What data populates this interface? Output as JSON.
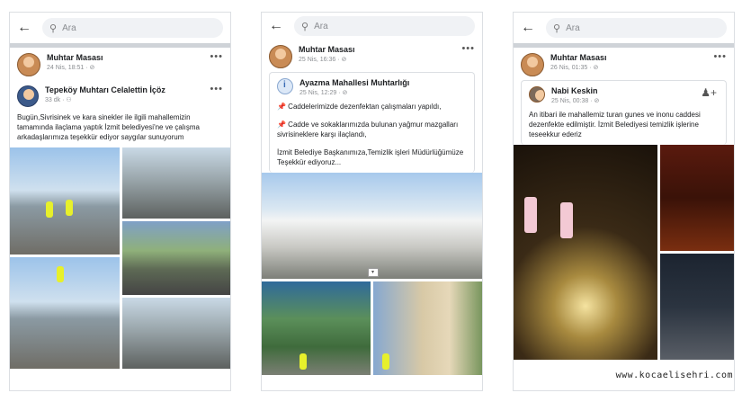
{
  "search": {
    "placeholder": "Ara"
  },
  "panels": [
    {
      "author": "Muhtar Masası",
      "time": "24 Nis, 18:51 · ⊘",
      "shared": {
        "author": "Tepeköy Muhtarı Celalettin İçöz",
        "time": "33 dk · ⚇",
        "text": "Bugün,Sivrisinek ve kara sinekler ile ilgili mahallemizin tamamında ilaçlama yaptık İzmit belediyesi'ne ve çalışma arkadaşlarımıza teşekkür ediyor saygılar sunuyorum"
      }
    },
    {
      "author": "Muhtar Masası",
      "time": "25 Nis, 16:36 · ⊘",
      "shared": {
        "author": "Ayazma Mahallesi Muhtarlığı",
        "time": "25 Nis, 12:29 · ⊘",
        "line1": "📌 Caddelerimizde dezenfektan çalışmaları yapıldı,",
        "line2": "📌 Cadde ve sokaklarımızda bulunan yağmur mazgalları sivrisineklere karşı ilaçlandı,",
        "line3": "İzmit Belediye Başkanımıza,Temizlik işleri Müdürlüğümüze Teşekkür ediyoruz..."
      }
    },
    {
      "author": "Muhtar Masası",
      "time": "26 Nis, 01:35 · ⊘",
      "shared": {
        "author": "Nabi Keskin",
        "time": "25 Nis, 00:38 · ⊘",
        "text": "An itibari ile mahallemiz turan gunes ve inonu caddesi dezenfekte edilmiştir. İzmit Belediyesi temizlik işlerine teseekkur ederiz"
      }
    }
  ],
  "watermark": "www.kocaelisehri.com"
}
